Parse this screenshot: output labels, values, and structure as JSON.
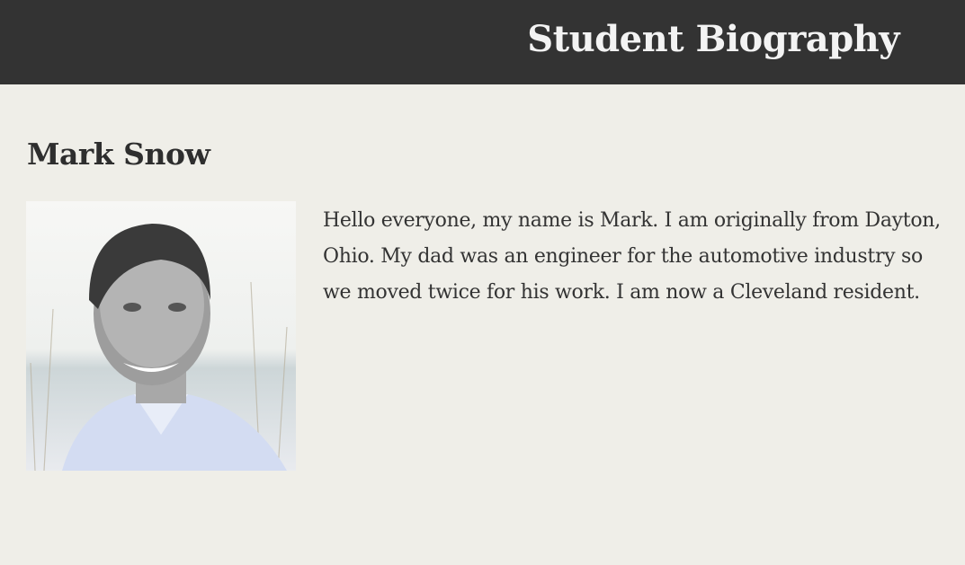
{
  "header": {
    "title": "Student Biography"
  },
  "student": {
    "name": "Mark Snow",
    "bio": "Hello everyone, my name is Mark. I am originally from Dayton, Ohio. My dad was an engineer for the automotive industry so we moved twice for his work. I am now a Cleveland resident."
  }
}
